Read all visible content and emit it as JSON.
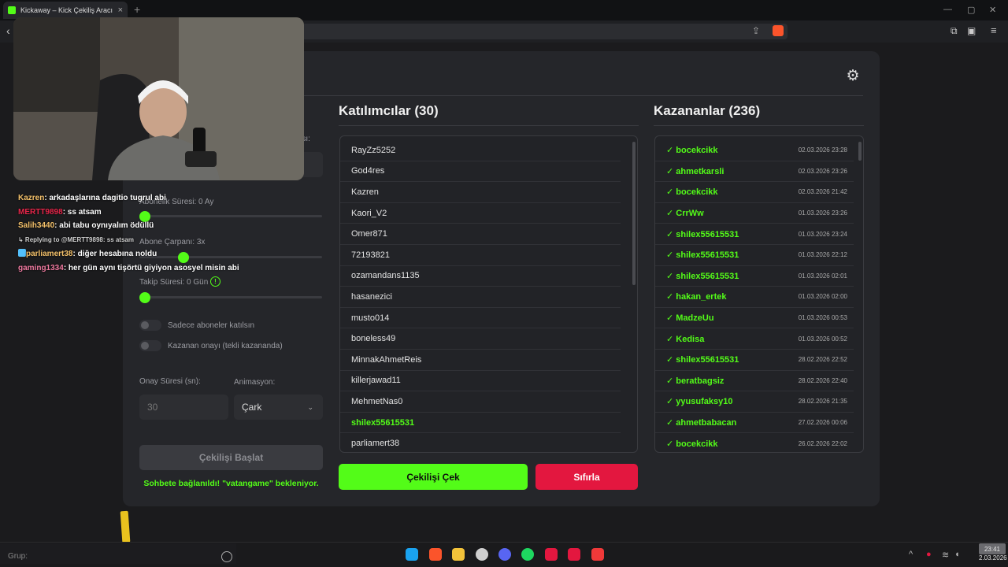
{
  "browser": {
    "tab_title": "Kickaway – Kick Çekiliş Aracı",
    "tab_close": "×",
    "new_tab": "+",
    "window_controls": [
      "—",
      "▢",
      "✕"
    ],
    "brave_badge": "1"
  },
  "app": {
    "settings_icon": "gear-icon",
    "participants_title": "Katılımcılar (30)",
    "winners_title": "Kazananlar (236)",
    "participants": [
      "RayZz5252",
      "God4res",
      "Kazren",
      "Kaori_V2",
      "Omer871",
      "72193821",
      "ozamandans1135",
      "hasanezici",
      "musto014",
      "boneless49",
      "MinnakAhmetReis",
      "killerjawad11",
      "MehmetNas0",
      "shilex55615531",
      "parliamert38"
    ],
    "participants_highlight_index": 13,
    "winners": [
      {
        "name": "bocekcikk",
        "date": "02.03.2026 23:28"
      },
      {
        "name": "ahmetkarsli",
        "date": "02.03.2026 23:26"
      },
      {
        "name": "bocekcikk",
        "date": "02.03.2026 21:42"
      },
      {
        "name": "CrrWw",
        "date": "01.03.2026 23:26"
      },
      {
        "name": "shilex55615531",
        "date": "01.03.2026 23:24"
      },
      {
        "name": "shilex55615531",
        "date": "01.03.2026 22:12"
      },
      {
        "name": "shilex55615531",
        "date": "01.03.2026 02:01"
      },
      {
        "name": "hakan_ertek",
        "date": "01.03.2026 02:00"
      },
      {
        "name": "MadzeUu",
        "date": "01.03.2026 00:53"
      },
      {
        "name": "Kedisa",
        "date": "01.03.2026 00:52"
      },
      {
        "name": "shilex55615531",
        "date": "28.02.2026 22:52"
      },
      {
        "name": "beratbagsiz",
        "date": "28.02.2026 22:40"
      },
      {
        "name": "yyusufaksy10",
        "date": "28.02.2026 21:35"
      },
      {
        "name": "ahmetbabacan",
        "date": "27.02.2026 00:06"
      },
      {
        "name": "bocekcikk",
        "date": "26.02.2026 22:02"
      }
    ],
    "winner_check": "✓",
    "settings": {
      "count_label_fragment": "ayısı:",
      "sub_duration_label": "Abonelik Süresi: 0 Ay",
      "sub_multiplier_label": "Abone Çarpanı: 3x",
      "follow_duration_label": "Takip Süresi: 0 Gün",
      "info_icon": "!",
      "subs_only_label": "Sadece aboneler katılsın",
      "winner_confirm_label": "Kazanan onayı (tekli kazananda)",
      "confirm_time_label": "Onay Süresi (sn):",
      "confirm_time_value": "30",
      "animation_label": "Animasyon:",
      "animation_value": "Çark"
    },
    "start_button": "Çekilişi Başlat",
    "status_text": "Sohbete bağlanıldı! \"vatangame\" bekleniyor.",
    "draw_button": "Çekilişi Çek",
    "reset_button": "Sıfırla"
  },
  "chat": [
    {
      "user": "Kazren",
      "color": "#f5c26b",
      "text": " arkadaşlarına dagitio tugrul abi"
    },
    {
      "user": "MERTT9898",
      "color": "#e8264a",
      "text": " ss atsam"
    },
    {
      "user": "Salih3440",
      "color": "#f5c26b",
      "text": " abi tabu oynıyalım ödüllü"
    },
    {
      "reply": "↳ Replying to @MERTT9898: ss atsam"
    },
    {
      "user": "parliamert38",
      "color": "#f5c26b",
      "text": " diğer hesabına noldu",
      "badge": true
    },
    {
      "user": "gaming1334",
      "color": "#f07aa0",
      "text": " her gün aynı tişörtü giyiyon asosyel misin abi"
    }
  ],
  "taskbar": {
    "search_placeholder": "Grup:",
    "time": "23:41",
    "date": "2.03.2026",
    "icons": [
      "windows-icon",
      "brave-icon",
      "files-icon",
      "chrome-icon",
      "discord-icon",
      "spotify-icon",
      "app-red-icon",
      "kick-icon",
      "vivaldi-icon"
    ]
  },
  "colors": {
    "accent_green": "#53fc18",
    "danger_red": "#e3173f",
    "panel_bg": "#25262a"
  }
}
